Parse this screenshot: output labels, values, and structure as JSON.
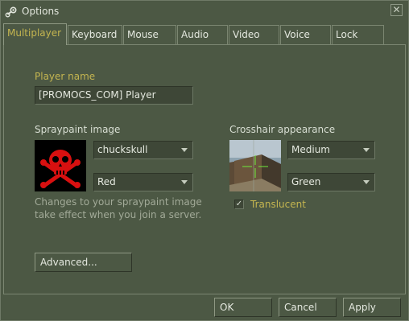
{
  "window": {
    "title": "Options",
    "icon": "steam-icon",
    "close_label": "✕"
  },
  "tabs": [
    {
      "label": "Multiplayer",
      "active": true
    },
    {
      "label": "Keyboard"
    },
    {
      "label": "Mouse"
    },
    {
      "label": "Audio"
    },
    {
      "label": "Video"
    },
    {
      "label": "Voice"
    },
    {
      "label": "Lock"
    }
  ],
  "multiplayer": {
    "player_name_label": "Player name",
    "player_name_value": "[PROMOCS_COM] Player",
    "spray_label": "Spraypaint image",
    "spray_image_select": "chuckskull",
    "spray_color_select": "Red",
    "spray_note": "Changes to your spraypaint image take effect when you join a server.",
    "crosshair_label": "Crosshair appearance",
    "crosshair_size_select": "Medium",
    "crosshair_color_select": "Green",
    "translucent_label": "Translucent",
    "translucent_checked": true,
    "advanced_button": "Advanced..."
  },
  "footer": {
    "ok": "OK",
    "cancel": "Cancel",
    "apply": "Apply"
  },
  "colors": {
    "background": "#4c5844",
    "accent_gold": "#c4b550",
    "field_bg": "#3e4737",
    "spray_red": "#d81010"
  }
}
